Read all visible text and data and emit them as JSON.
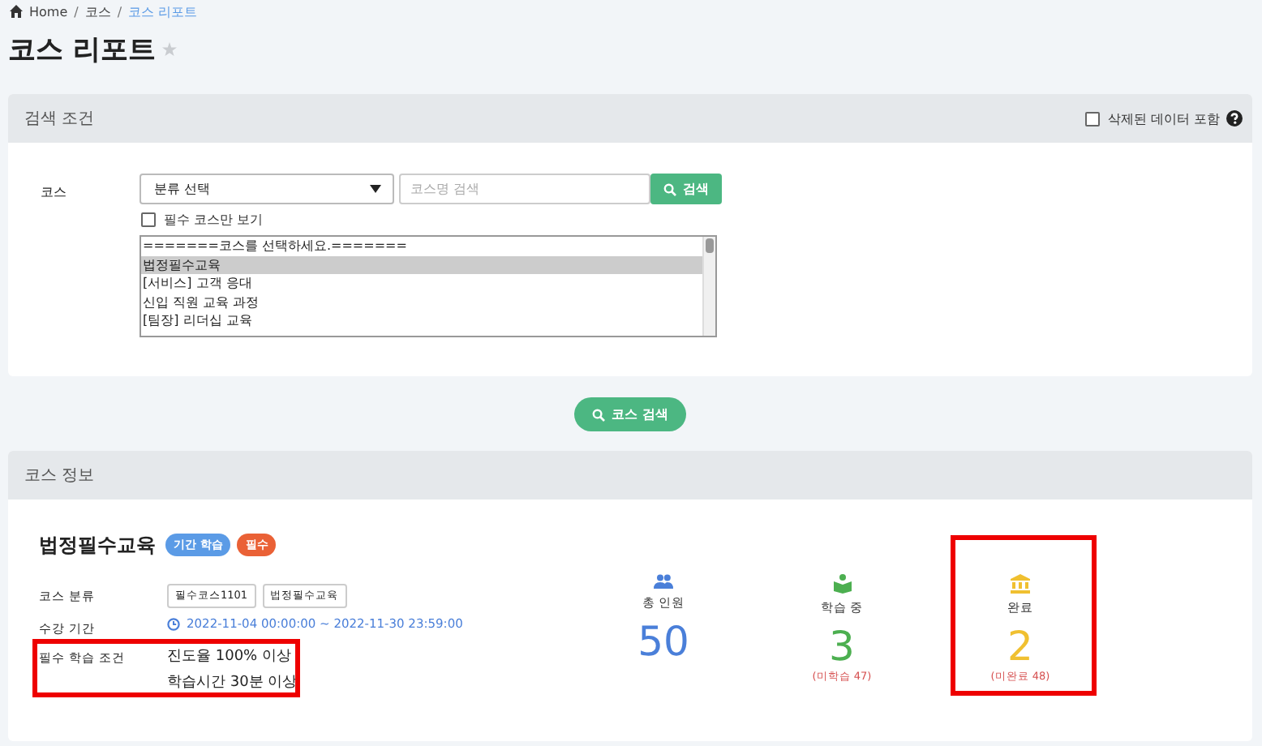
{
  "breadcrumb": [
    {
      "label": "Home",
      "current": false
    },
    {
      "separator": "/",
      "label": "코스",
      "current": false
    },
    {
      "separator": "/",
      "label": "코스 리포트",
      "current": true
    }
  ],
  "page_title": "코스 리포트",
  "favorite": {
    "on": false
  },
  "search_panel": {
    "title": "검색 조건",
    "include_deleted": {
      "label": "삭제된 데이터 포함",
      "checked": false
    },
    "course_label": "코스",
    "category_select": {
      "value": "분류 선택"
    },
    "name_search": {
      "placeholder": "코스명 검색"
    },
    "search_button": "검색",
    "required_only": {
      "label": "필수 코스만 보기",
      "checked": false
    },
    "course_list": [
      {
        "label": "=======코스를 선택하세요.=======",
        "selected": false
      },
      {
        "label": "법정필수교육",
        "selected": true
      },
      {
        "label": "[서비스] 고객 응대",
        "selected": false
      },
      {
        "label": "신입 직원 교육 과정",
        "selected": false
      },
      {
        "label": "[팀장] 리더십 교육",
        "selected": false
      }
    ]
  },
  "course_search_button": "코스 검색",
  "info_panel": {
    "title": "코스 정보",
    "course_name": "법정필수교육",
    "badges": [
      {
        "label": "기간 학습",
        "color": "#5b9be6"
      },
      {
        "label": "필수",
        "color": "#ea6136"
      }
    ],
    "fields": [
      {
        "label": "코스 분류",
        "kind": "tags",
        "tags": [
          "필수코스1101",
          "법정필수교육"
        ],
        "highlighted": false
      },
      {
        "label": "수강 기간",
        "kind": "period",
        "value": "2022-11-04 00:00:00 ~ 2022-11-30 23:59:00",
        "highlighted": false
      },
      {
        "label": "필수 학습 조건",
        "kind": "lines",
        "lines": [
          "진도율 100% 이상",
          "학습시간 30분 이상"
        ],
        "highlighted": true
      }
    ],
    "stats": [
      {
        "kind": "people",
        "label": "총 인원",
        "value": "50",
        "color": "#4a7fd9",
        "highlighted": false
      },
      {
        "kind": "book",
        "label": "학습 중",
        "value": "3",
        "note": "(미학습 47)",
        "color": "#4caf50",
        "highlighted": false
      },
      {
        "kind": "bank",
        "label": "완료",
        "value": "2",
        "note": "(미완료 48)",
        "color": "#f0c030",
        "highlighted": true
      }
    ]
  }
}
